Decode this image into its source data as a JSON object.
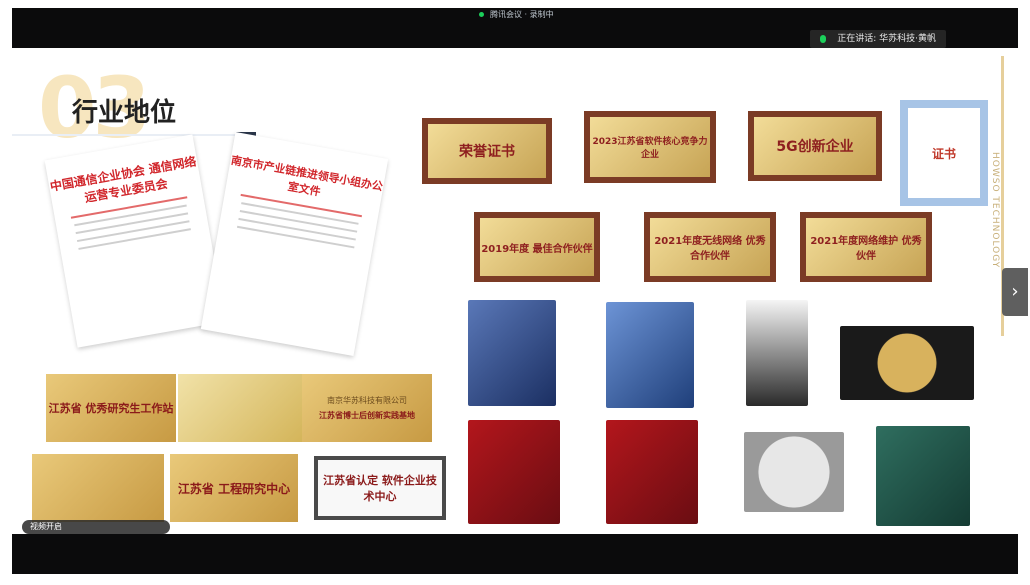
{
  "meeting": {
    "status_text": "腾讯会议 · 录制中",
    "speaker_label": "正在讲话: 华苏科技·黄帆"
  },
  "slide": {
    "section_number": "03",
    "title": "行业地位",
    "vertical_text": "HOWSO TECHNOLOGY"
  },
  "documents": {
    "doc1_title": "中国通信企业协会 通信网络运营专业委员会",
    "doc2_title": "南京市产业链推进领导小组办公室文件"
  },
  "plaques": {
    "honor_certificate": "荣誉证书",
    "p2023": "2023江苏省软件核心竞争力企业",
    "p5g": "5G创新企业",
    "certificate": "证书",
    "p2019": "2019年度 最佳合作伙伴",
    "p2021a": "2021年度无线网络 优秀合作伙伴",
    "p2021b": "2021年度网络维护 优秀伙伴",
    "jiangsu_workstation": "江苏省 优秀研究生工作站",
    "company_name": "南京华苏科技有限公司",
    "postdoc": "江苏省博士后创新实践基地",
    "jiangsu_engineering": "江苏省 工程研究中心",
    "jiangsu_software": "江苏省认定 软件企业技术中心"
  },
  "caption": {
    "text": "视频开启"
  },
  "colors": {
    "gold": "#d6b25e",
    "red": "#d1262b",
    "navy": "#2a3549"
  }
}
